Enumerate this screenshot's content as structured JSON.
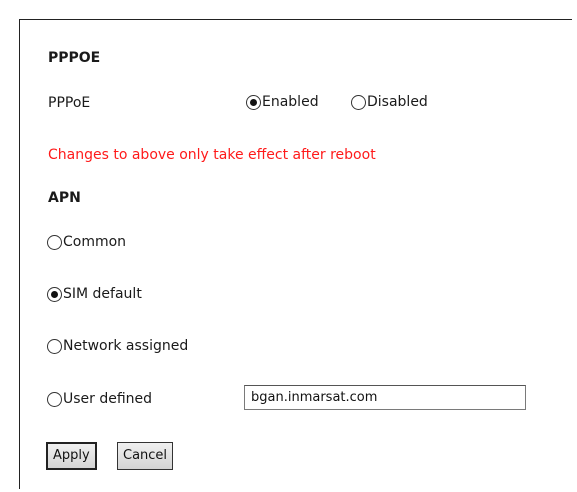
{
  "pppoe_section": {
    "heading": "PPPOE",
    "field_label": "PPPoE",
    "options": [
      {
        "label": "Enabled",
        "checked": true
      },
      {
        "label": "Disabled",
        "checked": false
      }
    ],
    "warning": "Changes to above only take effect after reboot",
    "warning_color": "#ff1a1a"
  },
  "apn_section": {
    "heading": "APN",
    "options": [
      {
        "label": "Common",
        "checked": false
      },
      {
        "label": "SIM default",
        "checked": true
      },
      {
        "label": "Network assigned",
        "checked": false
      },
      {
        "label": "User defined",
        "checked": false
      }
    ],
    "user_defined_value": "bgan.inmarsat.com"
  },
  "buttons": {
    "apply": "Apply",
    "cancel": "Cancel"
  }
}
